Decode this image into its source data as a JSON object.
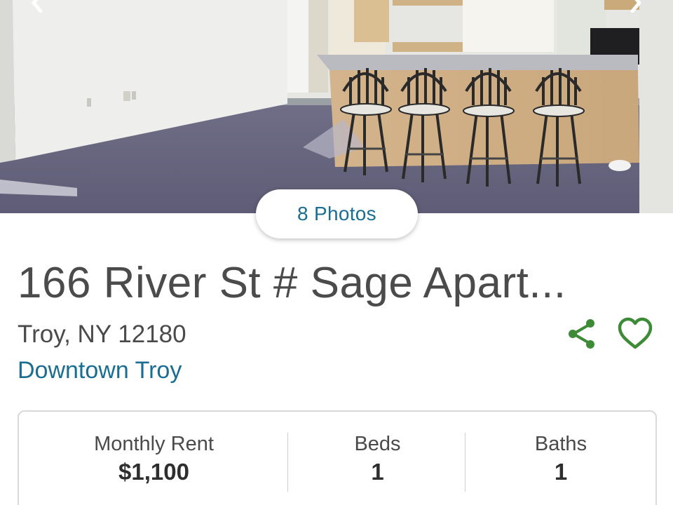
{
  "gallery": {
    "photo_description_icon": "kitchen-photo",
    "photos_button_label": "8 Photos",
    "nav_prev_icon": "chevron-left-icon",
    "nav_next_icon": "chevron-right-icon"
  },
  "listing": {
    "title": "166 River St # Sage Apart...",
    "address": "Troy, NY 12180",
    "neighborhood": "Downtown Troy"
  },
  "actions": {
    "share_icon": "share-icon",
    "favorite_icon": "heart-outline-icon"
  },
  "summary": {
    "rent_label": "Monthly Rent",
    "rent_value": "$1,100",
    "beds_label": "Beds",
    "beds_value": "1",
    "baths_label": "Baths",
    "baths_value": "1"
  },
  "colors": {
    "link_blue": "#1b6d92",
    "action_green": "#3d8b37",
    "card_border": "#d9d9d9"
  }
}
